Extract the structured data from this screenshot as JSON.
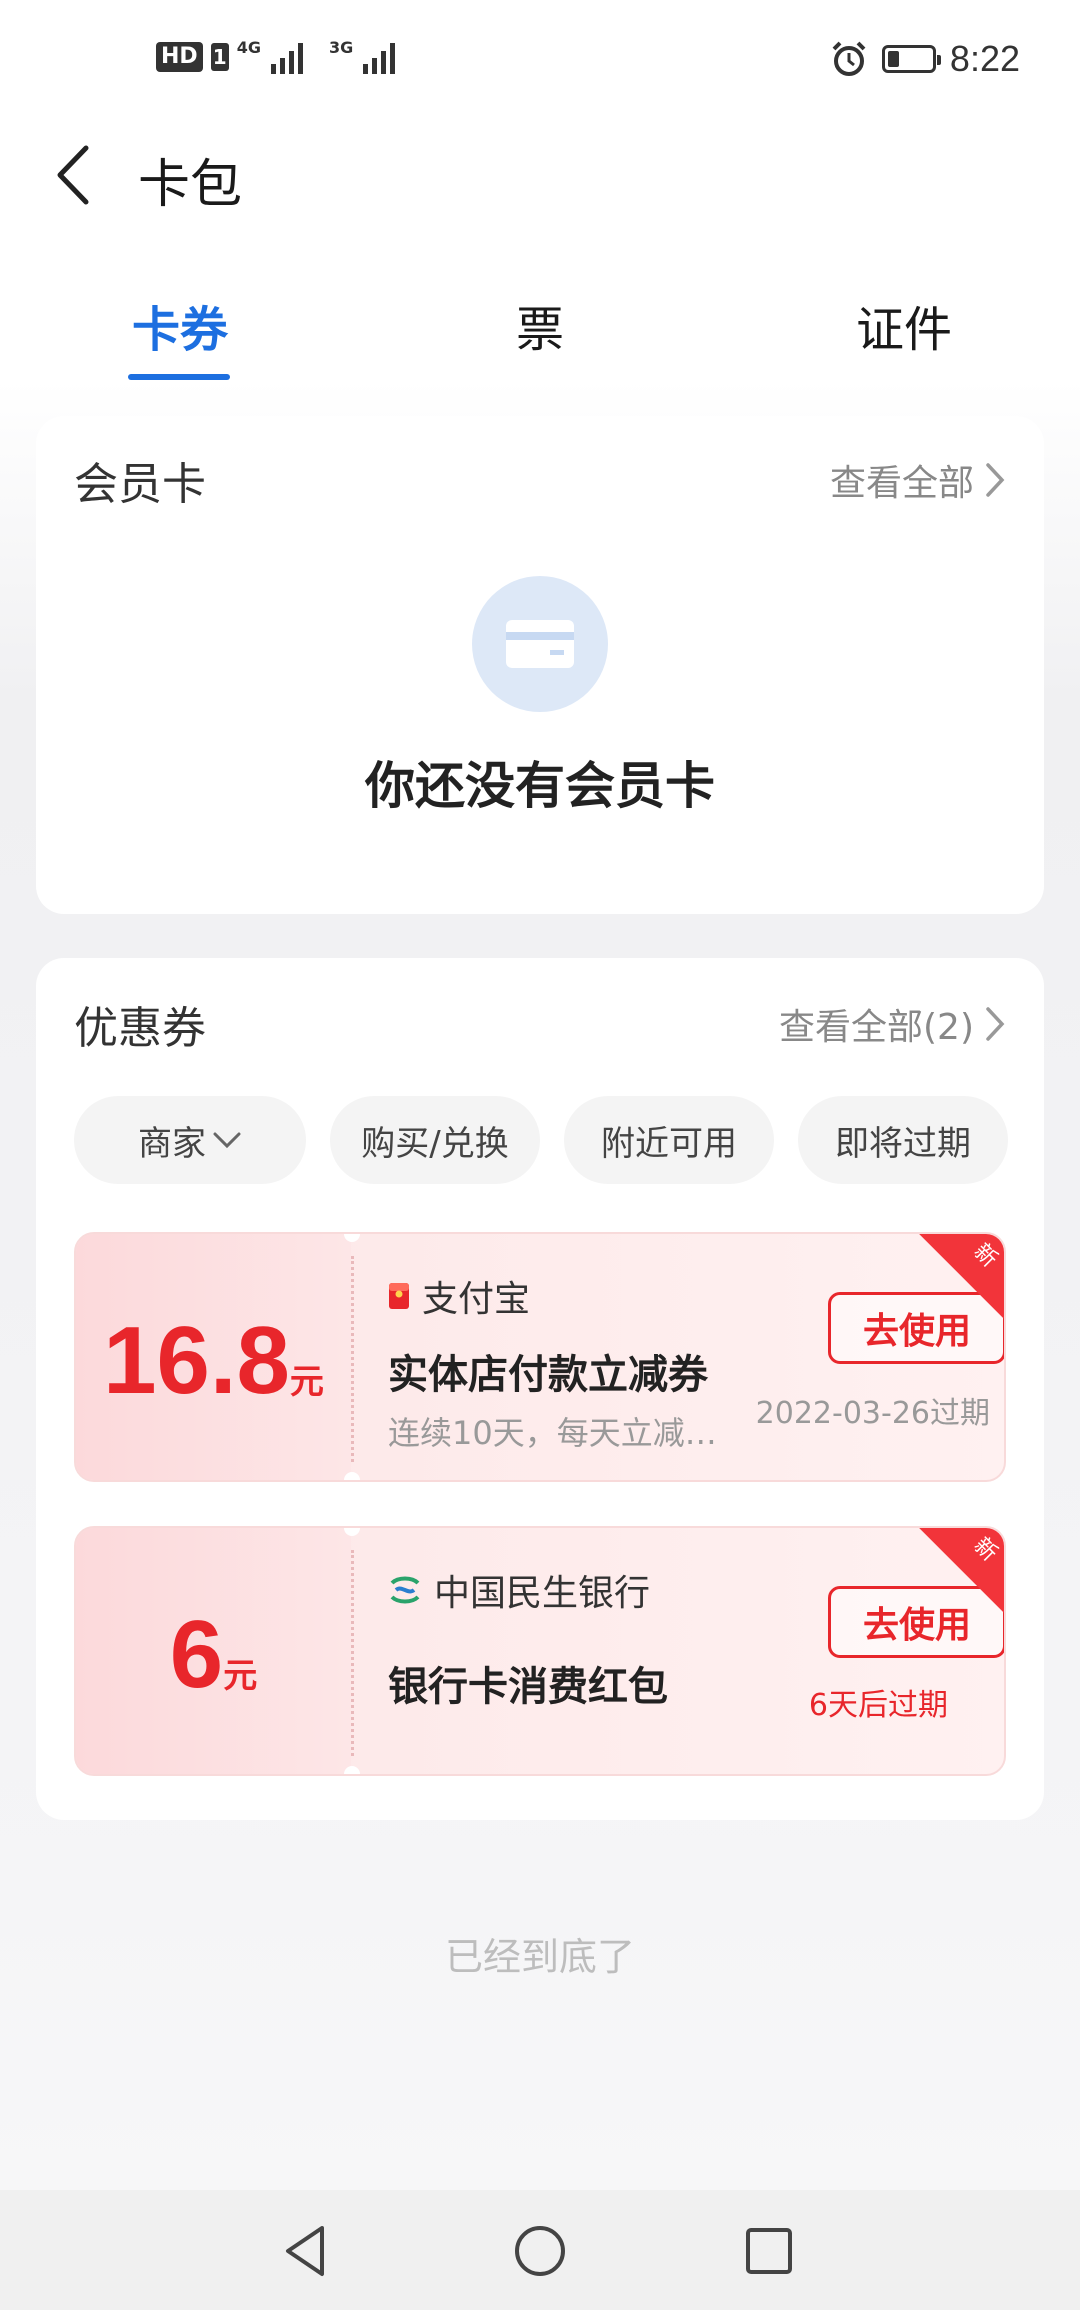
{
  "status": {
    "hd": "HD",
    "sim": "1",
    "net1": "4G",
    "net2": "3G",
    "time": "8:22",
    "battery_level": 0.25
  },
  "header": {
    "title": "卡包",
    "back_icon": "chevron-left-icon"
  },
  "tabs": [
    {
      "label": "卡券",
      "active": true
    },
    {
      "label": "票",
      "active": false
    },
    {
      "label": "证件",
      "active": false
    }
  ],
  "membership": {
    "title": "会员卡",
    "view_all": "查看全部",
    "empty_icon": "card-icon",
    "empty_text": "你还没有会员卡"
  },
  "coupons": {
    "title": "优惠券",
    "view_all": "查看全部(2)",
    "filters": [
      "商家",
      "购买/兑换",
      "附近可用",
      "即将过期"
    ],
    "items": [
      {
        "amount": "16.8",
        "unit": "元",
        "issuer": "支付宝",
        "title": "实体店付款立减券",
        "desc": "连续10天，每天立减…",
        "button": "去使用",
        "expire": "2022-03-26过期",
        "tag": "新"
      },
      {
        "amount": "6",
        "unit": "元",
        "issuer": "中国民生银行",
        "title": "银行卡消费红包",
        "desc": "",
        "button": "去使用",
        "expire": "6天后过期",
        "tag": "新"
      }
    ]
  },
  "footer_note": "已经到底了",
  "colors": {
    "accent": "#1d6fe0",
    "coupon_red": "#e8262b"
  }
}
